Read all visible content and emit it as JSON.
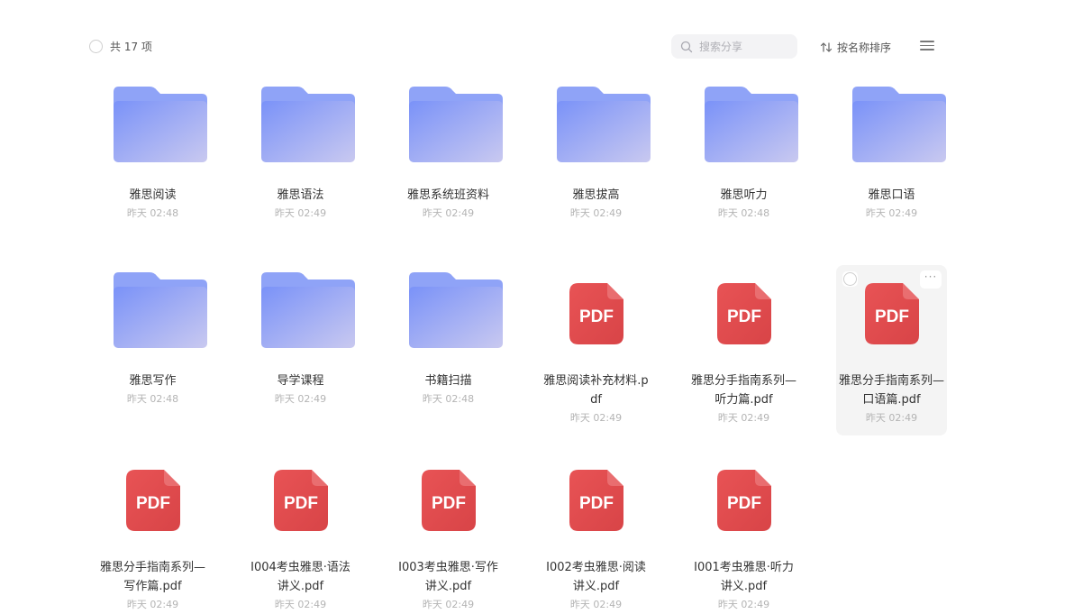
{
  "header": {
    "count_label": "共 17 项",
    "search_placeholder": "搜索分享",
    "sort_label": "按名称排序"
  },
  "colors": {
    "folder_back": "#8fa3f7",
    "folder_front_start": "#7a92f8",
    "folder_front_end": "#c9c9f0",
    "pdf_red": "#e04c4f",
    "selected_bg": "#f4f4f4"
  },
  "items": [
    {
      "type": "folder-icon",
      "name": "雅思阅读",
      "time": "昨天 02:48"
    },
    {
      "type": "folder-icon",
      "name": "雅思语法",
      "time": "昨天 02:49"
    },
    {
      "type": "folder-icon",
      "name": "雅思系统班资料",
      "time": "昨天 02:49"
    },
    {
      "type": "folder-icon",
      "name": "雅思拔高",
      "time": "昨天 02:49"
    },
    {
      "type": "folder-icon",
      "name": "雅思听力",
      "time": "昨天 02:48"
    },
    {
      "type": "folder-icon",
      "name": "雅思口语",
      "time": "昨天 02:49"
    },
    {
      "type": "folder-icon",
      "name": "雅思写作",
      "time": "昨天 02:48"
    },
    {
      "type": "folder-icon",
      "name": "导学课程",
      "time": "昨天 02:49"
    },
    {
      "type": "folder-icon",
      "name": "书籍扫描",
      "time": "昨天 02:48"
    },
    {
      "type": "pdf-icon",
      "name": "雅思阅读补充材料.pdf",
      "time": "昨天 02:49",
      "icon_text": "PDF"
    },
    {
      "type": "pdf-icon",
      "name": "雅思分手指南系列—听力篇.pdf",
      "time": "昨天 02:49",
      "icon_text": "PDF"
    },
    {
      "type": "pdf-icon",
      "name": "雅思分手指南系列—口语篇.pdf",
      "time": "昨天 02:49",
      "icon_text": "PDF",
      "selected": true
    },
    {
      "type": "pdf-icon",
      "name": "雅思分手指南系列—写作篇.pdf",
      "time": "昨天 02:49",
      "icon_text": "PDF"
    },
    {
      "type": "pdf-icon",
      "name": "I004考虫雅思·语法讲义.pdf",
      "time": "昨天 02:49",
      "icon_text": "PDF"
    },
    {
      "type": "pdf-icon",
      "name": "I003考虫雅思·写作讲义.pdf",
      "time": "昨天 02:49",
      "icon_text": "PDF"
    },
    {
      "type": "pdf-icon",
      "name": "I002考虫雅思·阅读讲义.pdf",
      "time": "昨天 02:49",
      "icon_text": "PDF"
    },
    {
      "type": "pdf-icon",
      "name": "I001考虫雅思·听力讲义.pdf",
      "time": "昨天 02:49",
      "icon_text": "PDF"
    }
  ]
}
